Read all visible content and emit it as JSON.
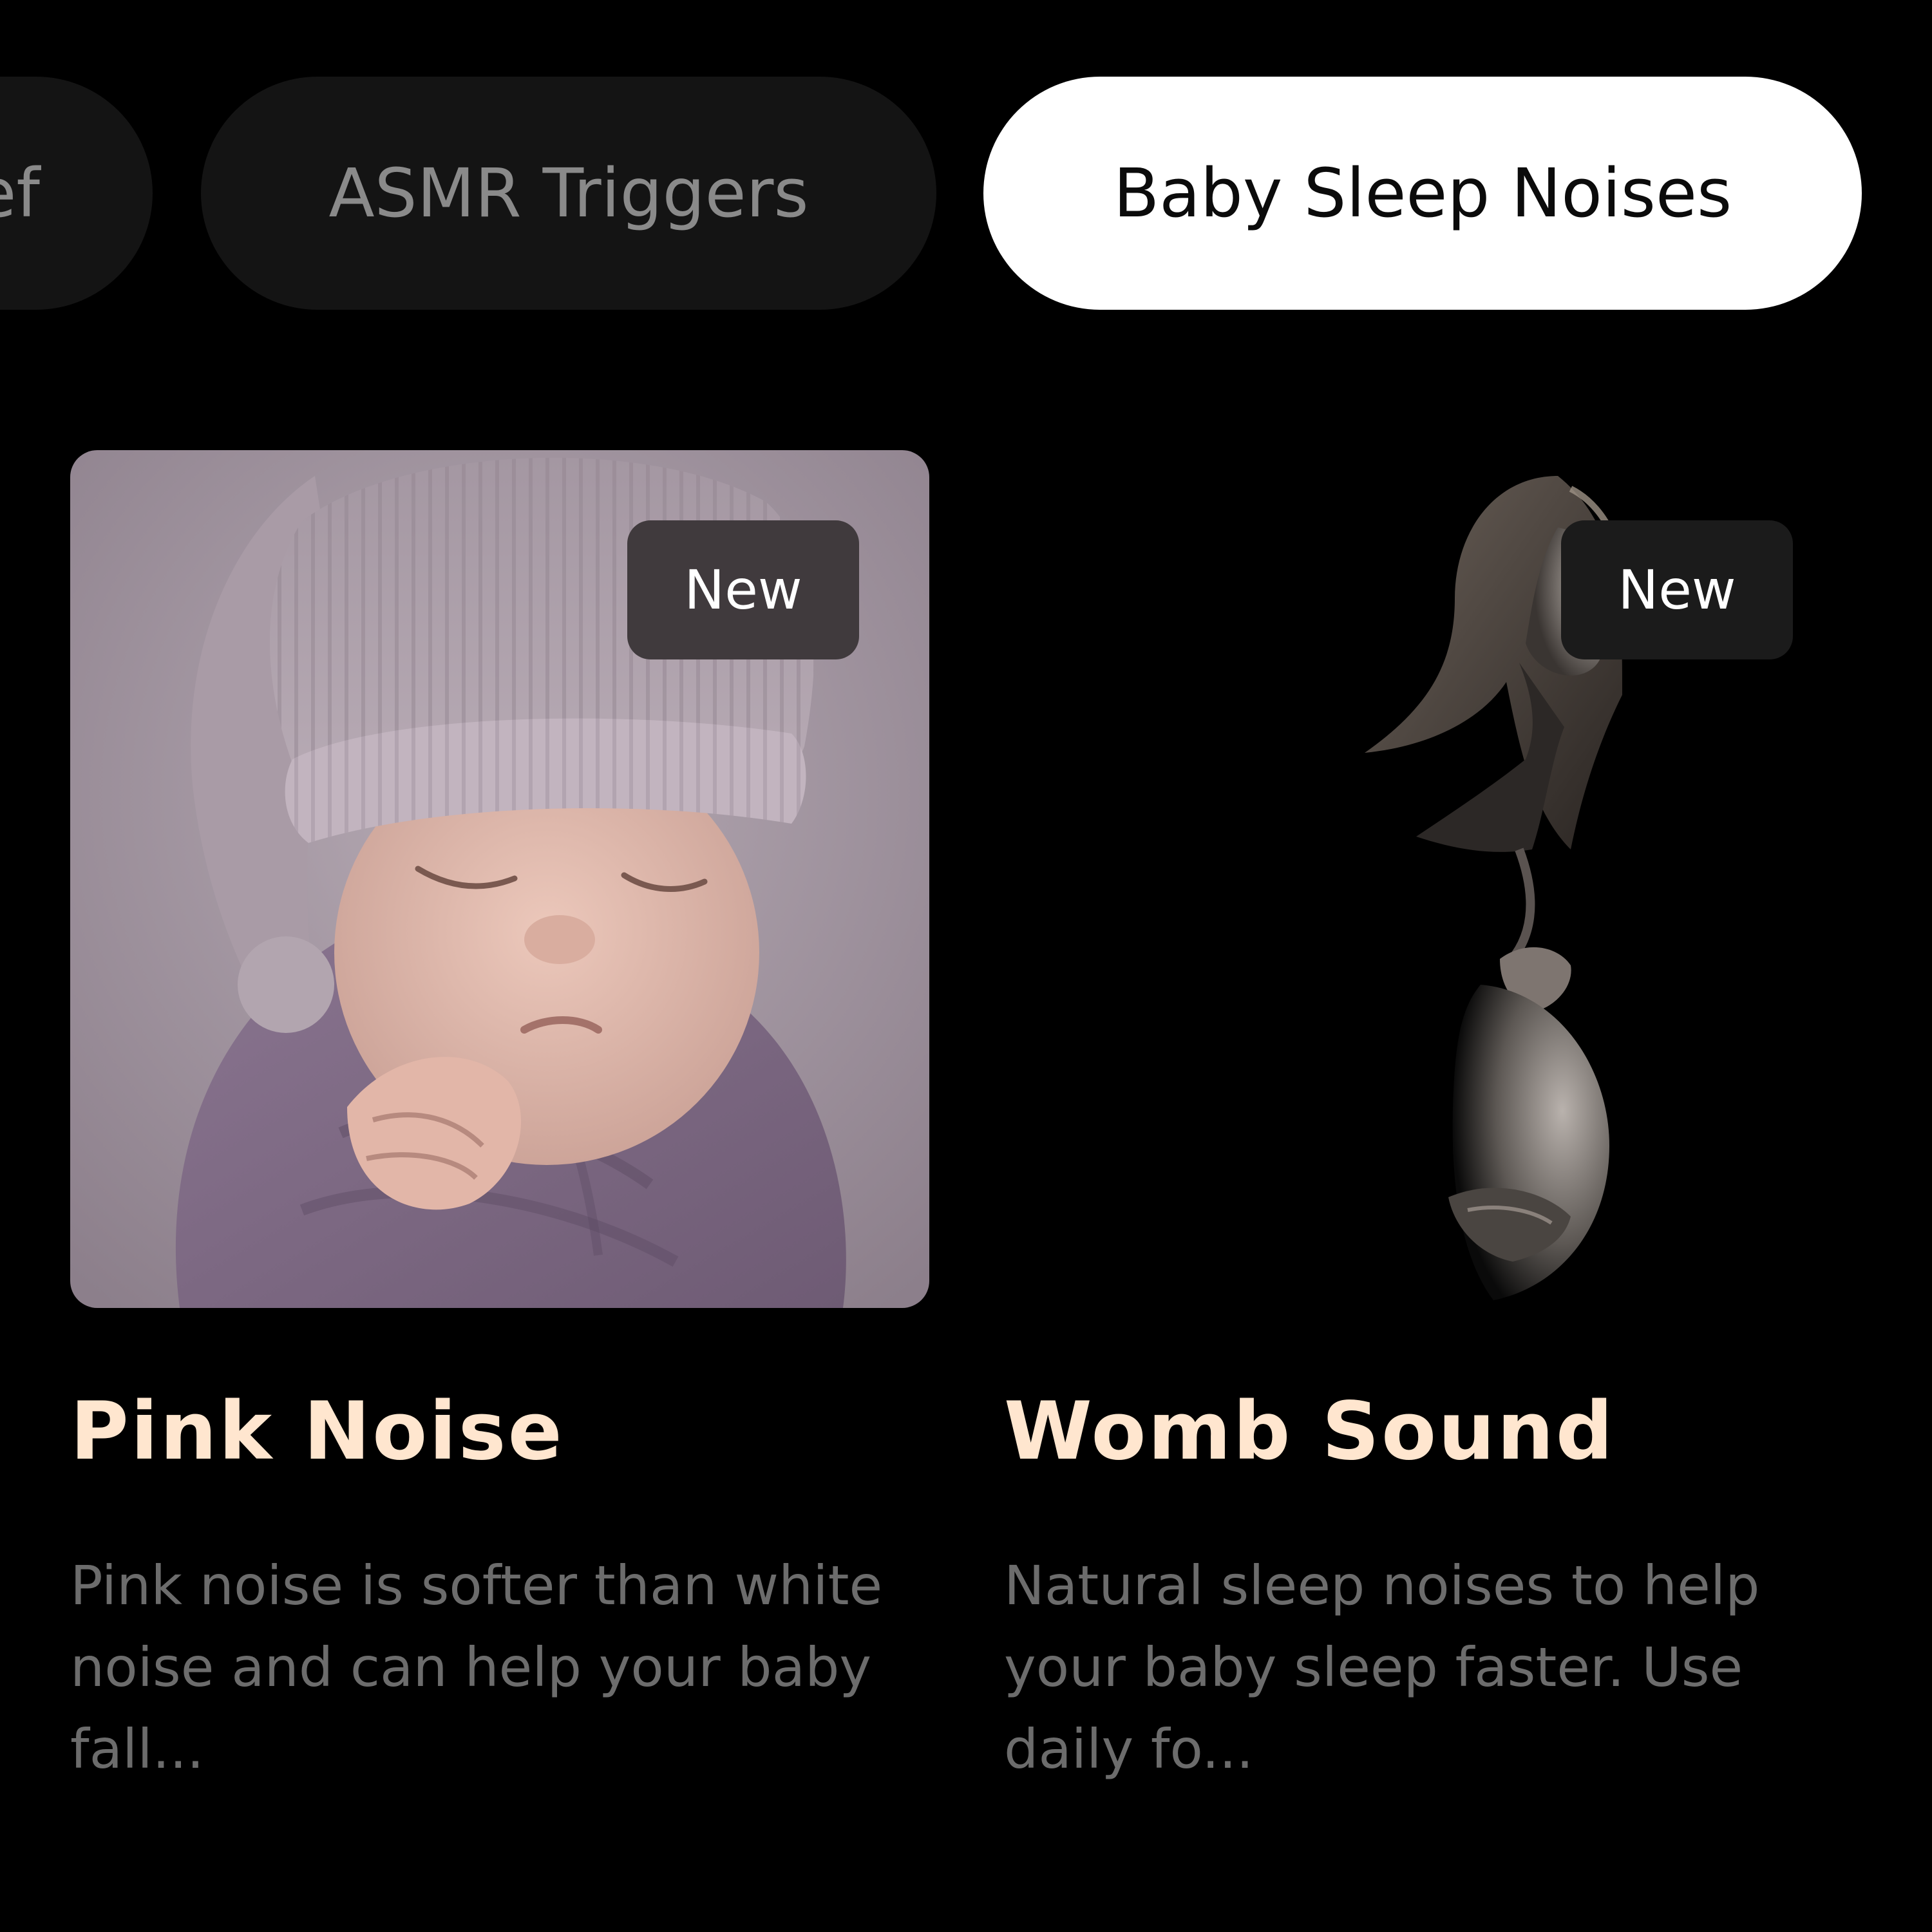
{
  "categories": {
    "partial_label": "ef",
    "items": [
      {
        "label": "ASMR Triggers",
        "selected": false
      },
      {
        "label": "Baby Sleep Noises",
        "selected": true
      }
    ]
  },
  "cards": [
    {
      "badge": "New",
      "title": "Pink Noise",
      "description": "Pink noise is softer than white noise and can help your baby fall..."
    },
    {
      "badge": "New",
      "title": "Womb Sound",
      "description": "Natural sleep noises to help your baby sleep faster. Use daily fo..."
    }
  ],
  "colors": {
    "background": "#000000",
    "chip_inactive_bg": "#141414",
    "chip_inactive_text": "#8a8a8a",
    "chip_active_bg": "#ffffff",
    "chip_active_text": "#0b0b0b",
    "title": "#ffe6cf",
    "description": "#6c6c6c"
  }
}
